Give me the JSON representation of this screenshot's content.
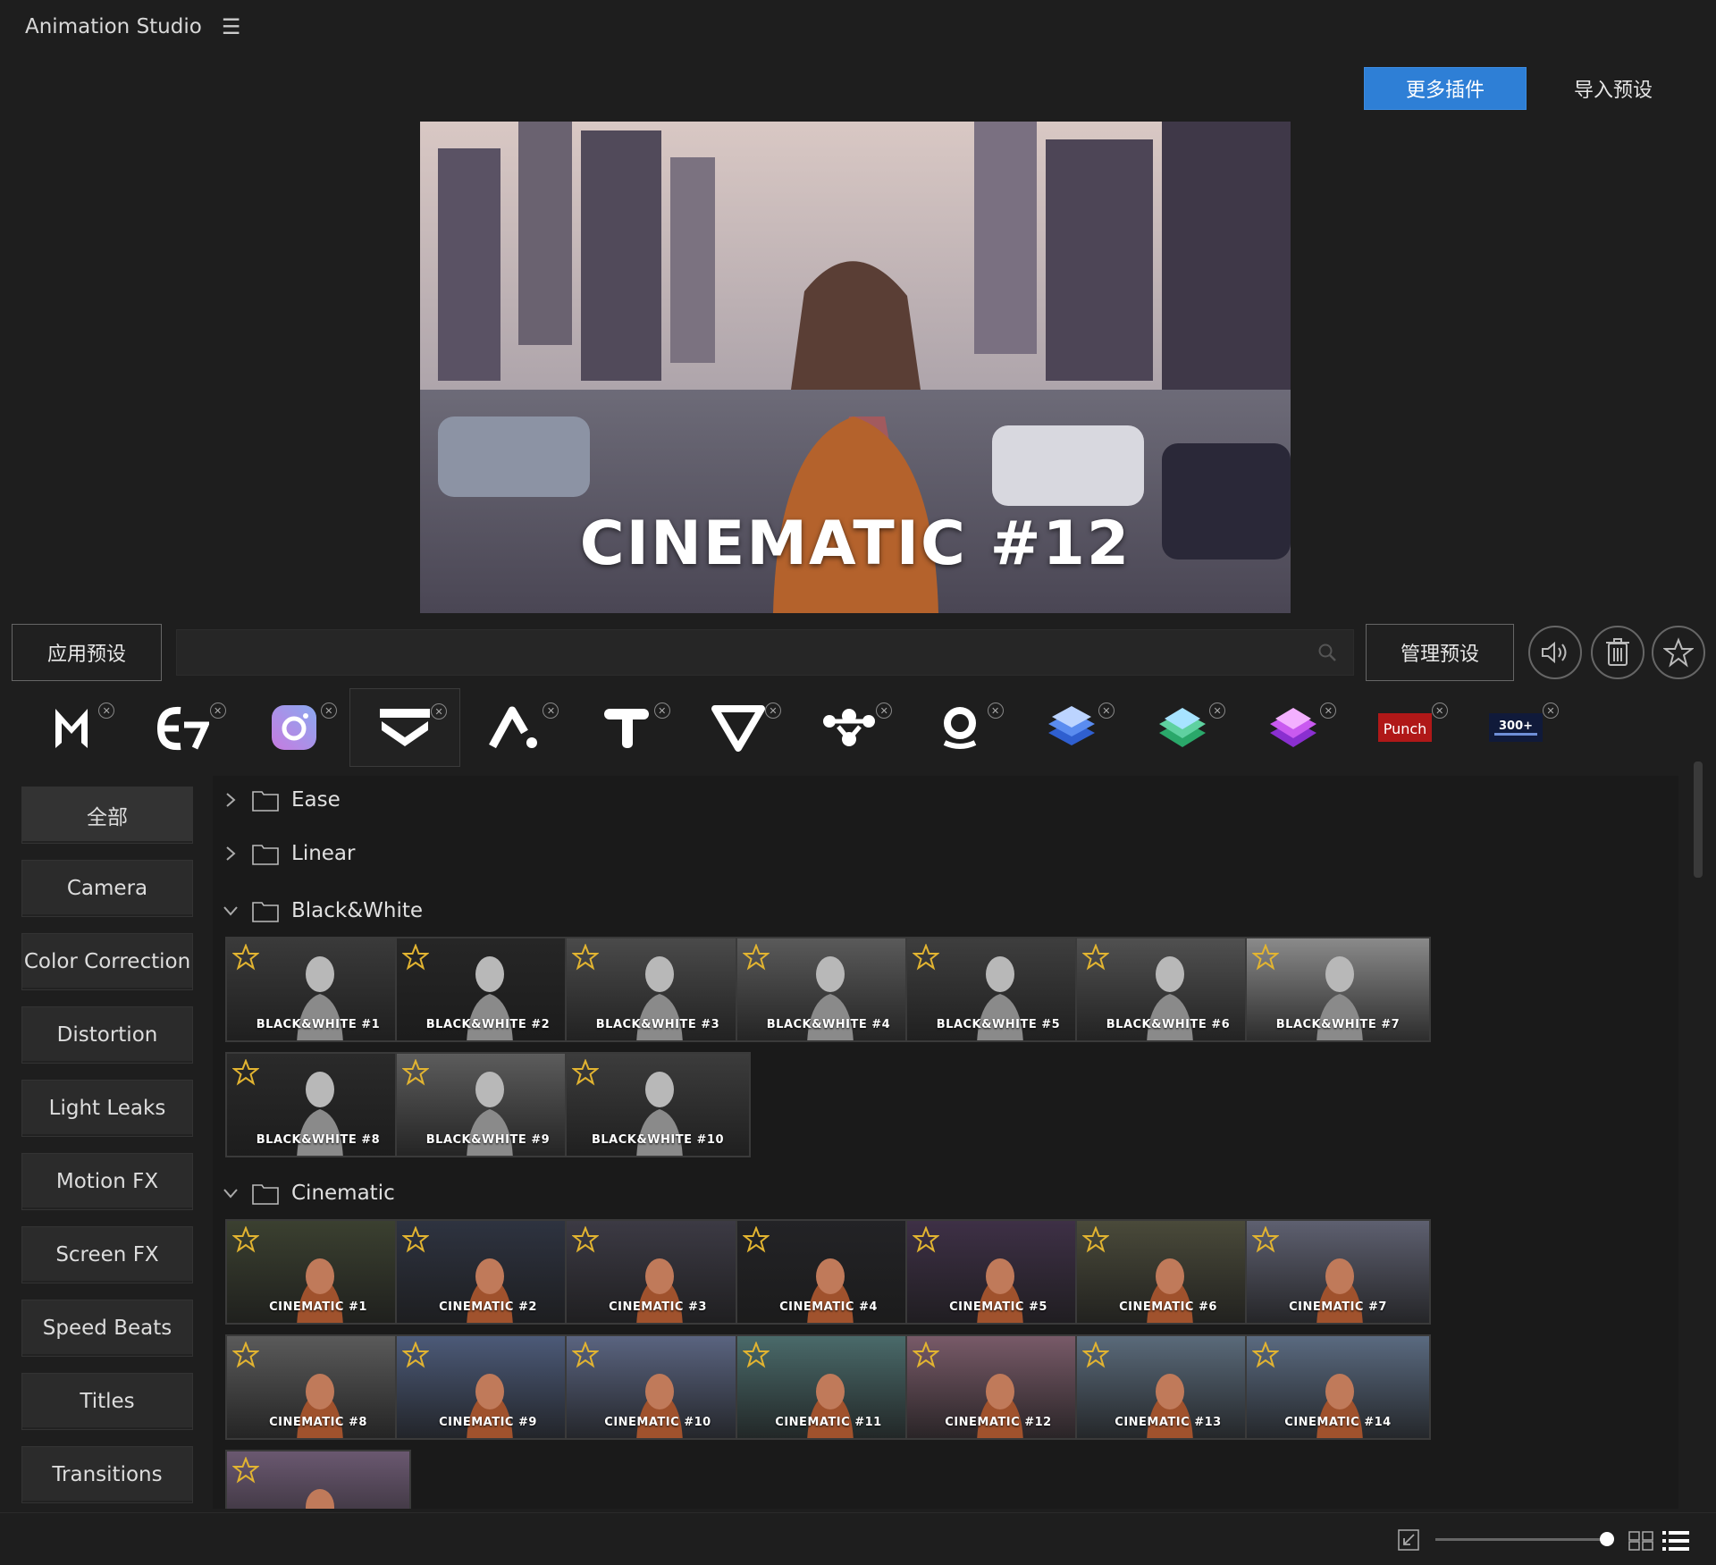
{
  "app": {
    "title": "Animation Studio"
  },
  "header": {
    "more_plugins": "更多插件",
    "import_presets": "导入预设"
  },
  "preview": {
    "label": "CINEMATIC #12"
  },
  "toolbar": {
    "apply": "应用预设",
    "search_placeholder": "",
    "manage": "管理预设",
    "icons": [
      "volume-icon",
      "trash-icon",
      "star-icon"
    ]
  },
  "plugins": [
    {
      "icon": "motion-m-logo-icon"
    },
    {
      "icon": "e7-logo-icon"
    },
    {
      "icon": "instagram-style-camera-icon"
    },
    {
      "icon": "layers-chevron-logo-icon"
    },
    {
      "icon": "a-logo-icon"
    },
    {
      "icon": "t-logo-icon"
    },
    {
      "icon": "v-logo-icon"
    },
    {
      "icon": "dots-logo-icon"
    },
    {
      "icon": "o-logo-icon"
    },
    {
      "icon": "blue-stack-icon"
    },
    {
      "icon": "green-stack-icon"
    },
    {
      "icon": "purple-stack-icon"
    },
    {
      "icon": "punch-logo-icon",
      "text": "Punch"
    },
    {
      "icon": "300-transitions-logo-icon",
      "text": "300+"
    }
  ],
  "sidebar": {
    "items": [
      "全部",
      "Camera",
      "Color Correction",
      "Distortion",
      "Light Leaks",
      "Motion FX",
      "Screen FX",
      "Speed Beats",
      "Titles",
      "Transitions"
    ]
  },
  "folders": {
    "ease": "Ease",
    "linear": "Linear",
    "bw": "Black&White",
    "cinematic": "Cinematic"
  },
  "bw_presets": [
    "BLACK&WHITE #1",
    "BLACK&WHITE #2",
    "BLACK&WHITE #3",
    "BLACK&WHITE #4",
    "BLACK&WHITE #5",
    "BLACK&WHITE #6",
    "BLACK&WHITE #7",
    "BLACK&WHITE #8",
    "BLACK&WHITE #9",
    "BLACK&WHITE #10"
  ],
  "cinematic_presets": [
    "CINEMATIC #1",
    "CINEMATIC #2",
    "CINEMATIC #3",
    "CINEMATIC #4",
    "CINEMATIC #5",
    "CINEMATIC #6",
    "CINEMATIC #7",
    "CINEMATIC #8",
    "CINEMATIC #9",
    "CINEMATIC #10",
    "CINEMATIC #11",
    "CINEMATIC #12",
    "CINEMATIC #13",
    "CINEMATIC #14",
    ""
  ],
  "colors": {
    "accent": "#2e7fd6",
    "star": "#e2b431",
    "background": "#1e1e1e"
  }
}
